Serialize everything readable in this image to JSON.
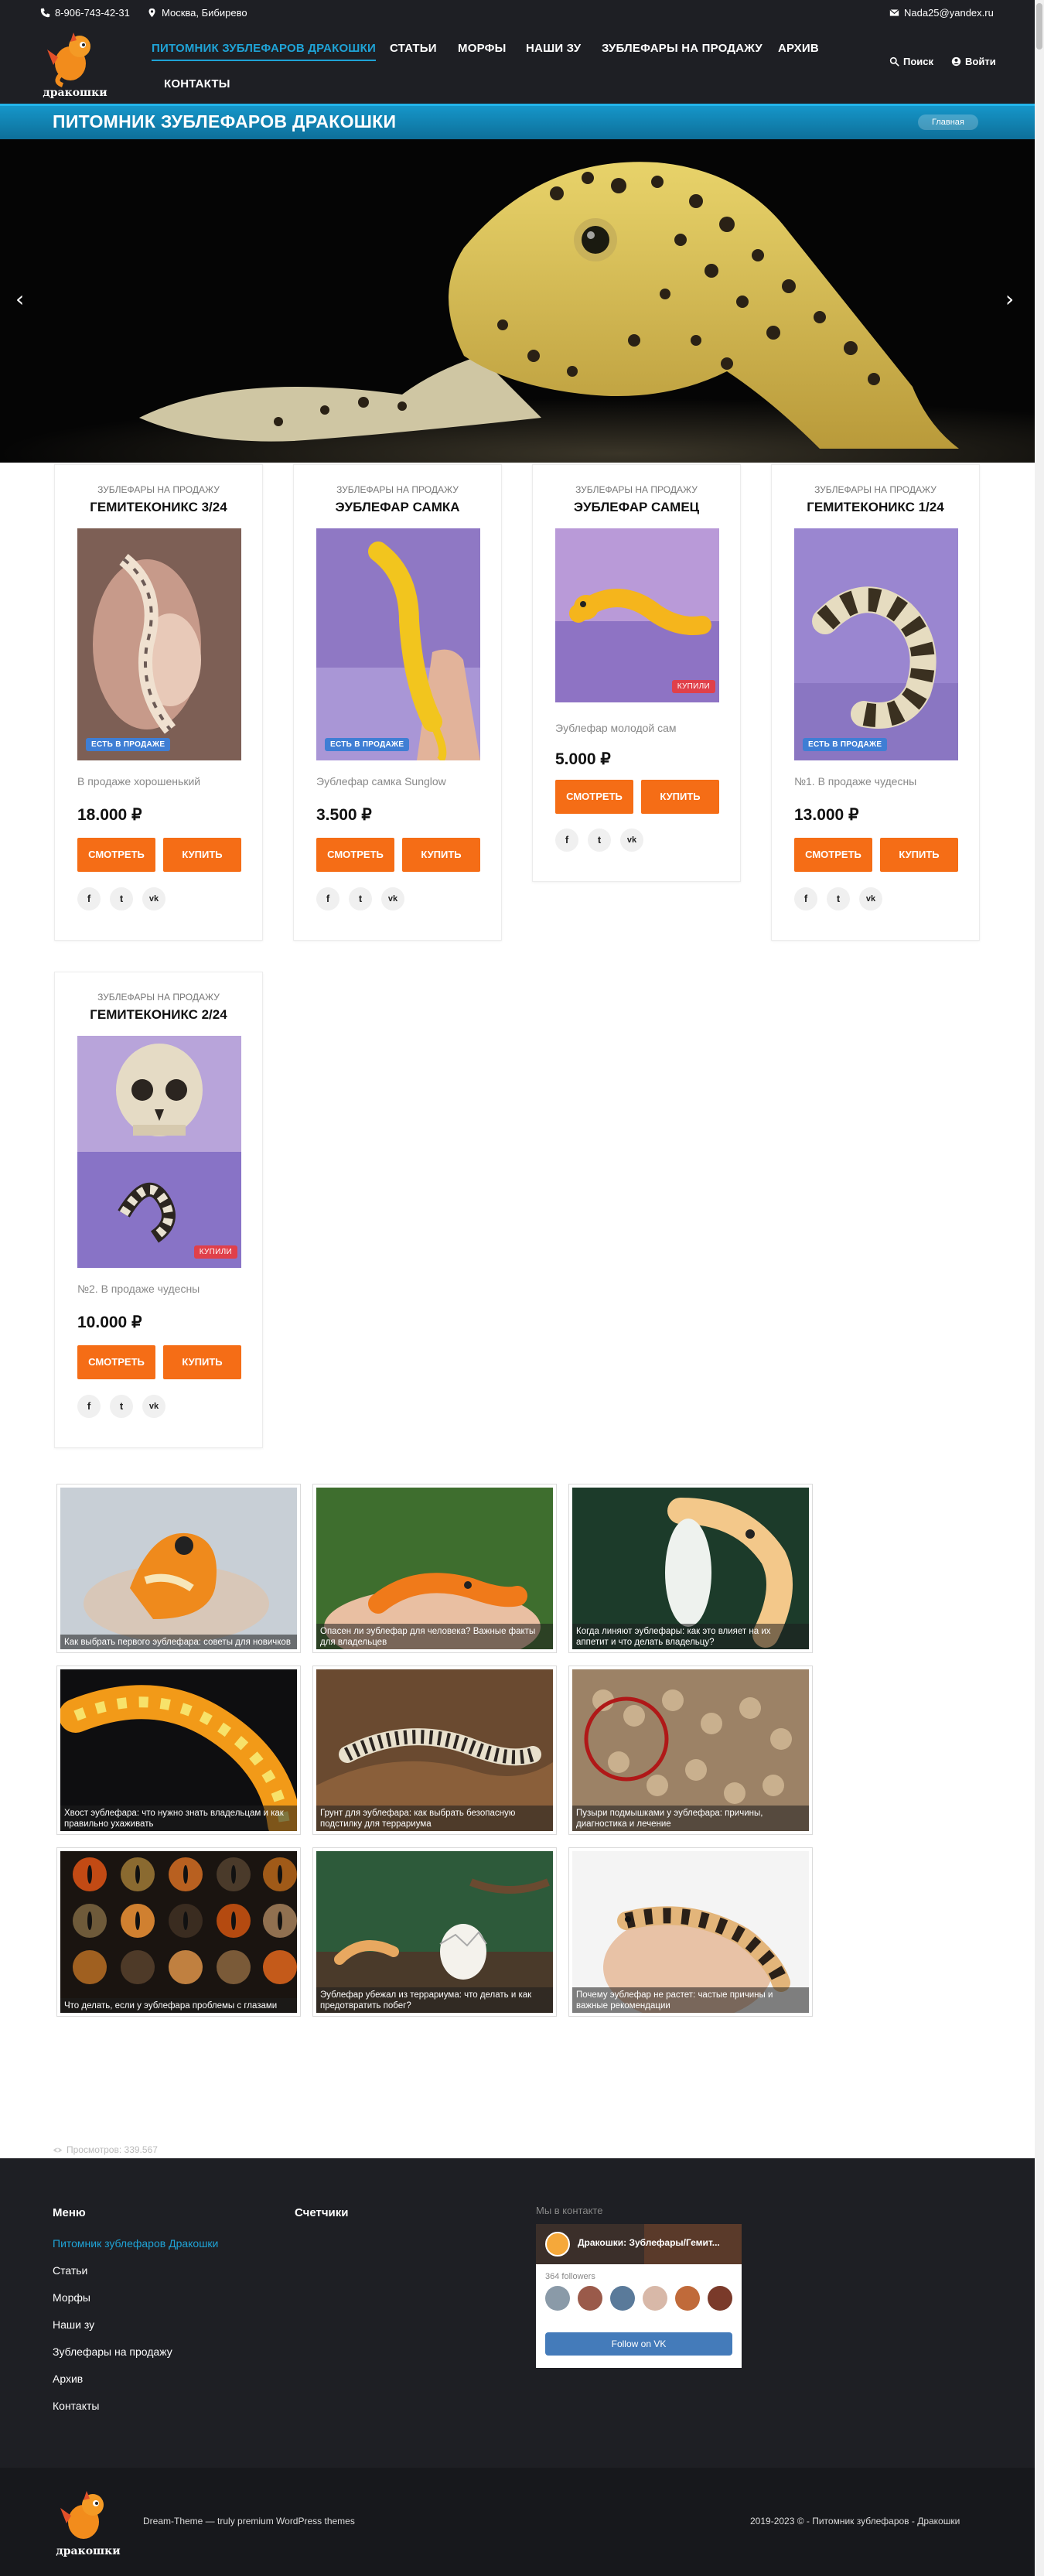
{
  "topbar": {
    "phone": "8-906-743-42-31",
    "location": "Москва, Бибирево",
    "email": "Nada25@yandex.ru"
  },
  "logo": {
    "text": "дракошки"
  },
  "nav": [
    {
      "label": "ПИТОМНИК ЗУБЛЕФАРОВ ДРАКОШКИ",
      "active": true
    },
    {
      "label": "СТАТЬИ"
    },
    {
      "label": "МОРФЫ"
    },
    {
      "label": "НАШИ ЗУ"
    },
    {
      "label": "ЗУБЛЕФАРЫ НА ПРОДАЖУ"
    },
    {
      "label": "АРХИВ"
    },
    {
      "label": "КОНТАКТЫ"
    }
  ],
  "header": {
    "search_label": "Поиск",
    "login_label": "Войти"
  },
  "title_bar": {
    "title": "ПИТОМНИК ЗУБЛЕФАРОВ ДРАКОШКИ",
    "breadcrumb": "Главная"
  },
  "products": [
    {
      "category": "ЗУБЛЕФАРЫ НА ПРОДАЖУ",
      "name": "ГЕМИТЕКОНИКС 3/24",
      "badge": "ЕСТЬ В ПРОДАЖЕ",
      "desc": "В продаже хорошенький",
      "price": "18.000 ₽",
      "btn_view": "СМОТРЕТЬ",
      "btn_buy": "КУПИТЬ"
    },
    {
      "category": "ЗУБЛЕФАРЫ НА ПРОДАЖУ",
      "name": "ЭУБЛЕФАР САМКА",
      "badge": "ЕСТЬ В ПРОДАЖЕ",
      "desc": "Эублефар  самка Sunglow",
      "price": "3.500 ₽",
      "btn_view": "СМОТРЕТЬ",
      "btn_buy": "КУПИТЬ"
    },
    {
      "category": "ЗУБЛЕФАРЫ НА ПРОДАЖУ",
      "name": "ЭУБЛЕФАР САМЕЦ",
      "badge": "КУПИЛИ",
      "desc": "Эублефар молодой сам",
      "price": "5.000 ₽",
      "btn_view": "СМОТРЕТЬ",
      "btn_buy": "КУПИТЬ"
    },
    {
      "category": "ЗУБЛЕФАРЫ НА ПРОДАЖУ",
      "name": "ГЕМИТЕКОНИКС 1/24",
      "badge": "ЕСТЬ В ПРОДАЖЕ",
      "desc": "№1. В продаже чудесны",
      "price": "13.000 ₽",
      "btn_view": "СМОТРЕТЬ",
      "btn_buy": "КУПИТЬ"
    },
    {
      "category": "ЗУБЛЕФАРЫ НА ПРОДАЖУ",
      "name": "ГЕМИТЕКОНИКС 2/24",
      "badge": "КУПИЛИ",
      "desc": "№2. В продаже чудесны",
      "price": "10.000 ₽",
      "btn_view": "СМОТРЕТЬ",
      "btn_buy": "КУПИТЬ"
    }
  ],
  "social": {
    "facebook": "f",
    "twitter": "t",
    "vk": "vk"
  },
  "articles": [
    {
      "caption": "Как выбрать первого эублефара: советы для новичков"
    },
    {
      "caption": "Опасен ли эублефар для человека? Важные факты для владельцев"
    },
    {
      "caption": "Когда линяют эублефары: как это влияет на их аппетит и что делать владельцу?"
    },
    {
      "caption": "Хвост эублефара: что нужно знать владельцам и как правильно ухаживать"
    },
    {
      "caption": "Грунт для эублефара: как выбрать безопасную подстилку для террариума"
    },
    {
      "caption": "Пузыри подмышками у эублефара: причины, диагностика и лечение"
    },
    {
      "caption": "Что делать, если у эублефара проблемы с глазами"
    },
    {
      "caption": "Эублефар убежал из террариума: что делать и как предотвратить побег?"
    },
    {
      "caption": "Почему эублефар не растет: частые причины и важные рекомендации"
    }
  ],
  "views": "Просмотров: 339.567",
  "footer": {
    "menu_heading": "Меню",
    "menu": [
      "Питомник зублефаров Дракошки",
      "Статьи",
      "Морфы",
      "Наши зу",
      "Зублефары на продажу",
      "Архив",
      "Контакты"
    ],
    "counters_heading": "Счетчики",
    "vk_heading": "Мы в контакте",
    "vk_group": "Дракошки: Зублефары/Гемит...",
    "vk_followers": "364 followers",
    "vk_button": "Follow on VK",
    "theme_credit": "Dream-Theme — truly premium WordPress themes",
    "copyright": "2019-2023 © - Питомник зублефаров - Дракошки"
  },
  "colors": {
    "accent": "#1fa3d6",
    "button": "#f56d16",
    "dark": "#1e1f24",
    "badge_sale": "#3f7ed4",
    "badge_sold": "#e0404a"
  }
}
